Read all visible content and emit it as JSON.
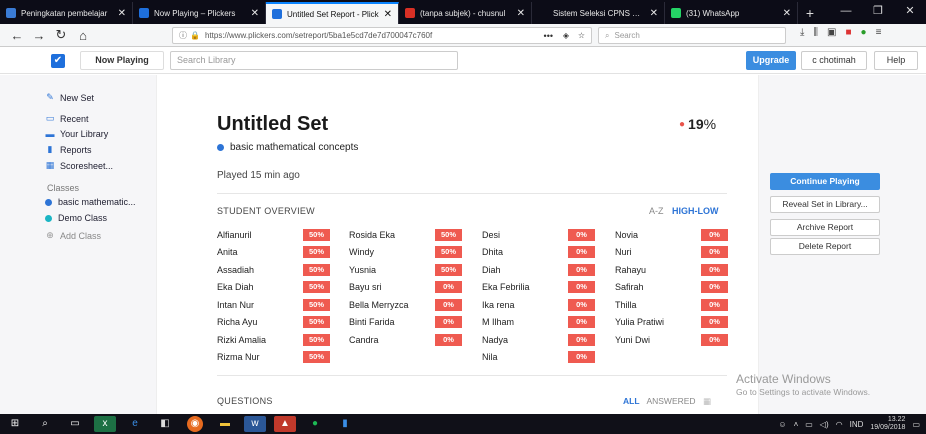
{
  "browser": {
    "tabs": [
      {
        "label": "Peningkatan pembelajar",
        "favicon_color": "#3a7bd5",
        "active": false
      },
      {
        "label": "Now Playing – Plickers",
        "favicon_color": "#1e6fdc",
        "active": false
      },
      {
        "label": "Untitled Set Report - Plick",
        "favicon_color": "#1e6fdc",
        "active": true
      },
      {
        "label": "(tanpa subjek) - chusnul",
        "favicon_color": "#d93025",
        "active": false
      },
      {
        "label": "Sistem Seleksi CPNS Nasiona",
        "favicon_color": "#0c0c17",
        "active": false
      },
      {
        "label": "(31) WhatsApp",
        "favicon_color": "#25d366",
        "active": false
      }
    ],
    "new_tab": "+",
    "url": "https://www.plickers.com/setreport/5ba1e5cd7de7d700047c760f",
    "url_domain": "plickers.com",
    "search_placeholder": "Search",
    "page_actions": "•••"
  },
  "app": {
    "now_playing": "Now Playing",
    "search_placeholder": "Search Library",
    "upgrade": "Upgrade",
    "user": "c chotimah",
    "help": "Help",
    "brand_color": "#1e6fdc"
  },
  "sidebar": {
    "new_set": "New Set",
    "nav": [
      {
        "label": "Recent",
        "icon": "recent-icon",
        "glyph": "▭"
      },
      {
        "label": "Your Library",
        "icon": "library-icon",
        "glyph": "▬"
      },
      {
        "label": "Reports",
        "icon": "reports-icon",
        "glyph": "▮"
      },
      {
        "label": "Scoresheet...",
        "icon": "scoresheet-icon",
        "glyph": "▦"
      }
    ],
    "classes_header": "Classes",
    "classes": [
      {
        "label": "basic mathematic...",
        "color": "#2d74d6"
      },
      {
        "label": "Demo Class",
        "color": "#1bb5c4"
      }
    ],
    "add_class": "Add Class"
  },
  "report": {
    "title": "Untitled Set",
    "score_value": "19",
    "score_symbol": "%",
    "class_name": "basic mathematical concepts",
    "class_color": "#2d74d6",
    "played": "Played 15 min ago",
    "student_overview": "STUDENT OVERVIEW",
    "sort_az": "A-Z",
    "sort_high_low": "HIGH-LOW",
    "questions_header": "QUESTIONS",
    "filter_all": "ALL",
    "filter_answered": "ANSWERED",
    "score_colors": {
      "high": "#ef5a50",
      "low": "#ef5a50"
    },
    "students": [
      [
        {
          "name": "Alfianuril",
          "score": "50%"
        },
        {
          "name": "Anita",
          "score": "50%"
        },
        {
          "name": "Assadiah",
          "score": "50%"
        },
        {
          "name": "Eka Diah",
          "score": "50%"
        },
        {
          "name": "Intan Nur",
          "score": "50%"
        },
        {
          "name": "Richa Ayu",
          "score": "50%"
        },
        {
          "name": "Rizki Amalia",
          "score": "50%"
        },
        {
          "name": "Rizma Nur",
          "score": "50%"
        }
      ],
      [
        {
          "name": "Rosida Eka",
          "score": "50%"
        },
        {
          "name": "Windy",
          "score": "50%"
        },
        {
          "name": "Yusnia",
          "score": "50%"
        },
        {
          "name": "Bayu sri",
          "score": "0%"
        },
        {
          "name": "Bella Merryzca",
          "score": "0%"
        },
        {
          "name": "Binti Farida",
          "score": "0%"
        },
        {
          "name": "Candra",
          "score": "0%"
        }
      ],
      [
        {
          "name": "Desi",
          "score": "0%"
        },
        {
          "name": "Dhita",
          "score": "0%"
        },
        {
          "name": "Diah",
          "score": "0%"
        },
        {
          "name": "Eka Febrilia",
          "score": "0%"
        },
        {
          "name": "Ika rena",
          "score": "0%"
        },
        {
          "name": "M Ilham",
          "score": "0%"
        },
        {
          "name": "Nadya",
          "score": "0%"
        },
        {
          "name": "Nila",
          "score": "0%"
        }
      ],
      [
        {
          "name": "Novia",
          "score": "0%"
        },
        {
          "name": "Nuri",
          "score": "0%"
        },
        {
          "name": "Rahayu",
          "score": "0%"
        },
        {
          "name": "Safirah",
          "score": "0%"
        },
        {
          "name": "Thilla",
          "score": "0%"
        },
        {
          "name": "Yulia Pratiwi",
          "score": "0%"
        },
        {
          "name": "Yuni Dwi",
          "score": "0%"
        }
      ]
    ]
  },
  "actions": {
    "continue_playing": "Continue Playing",
    "reveal": "Reveal Set in Library...",
    "archive": "Archive Report",
    "delete": "Delete Report"
  },
  "watermark": {
    "line1": "Activate Windows",
    "line2": "Go to Settings to activate Windows."
  },
  "taskbar": {
    "lang": "IND",
    "time": "13.22",
    "date": "19/09/2018"
  }
}
